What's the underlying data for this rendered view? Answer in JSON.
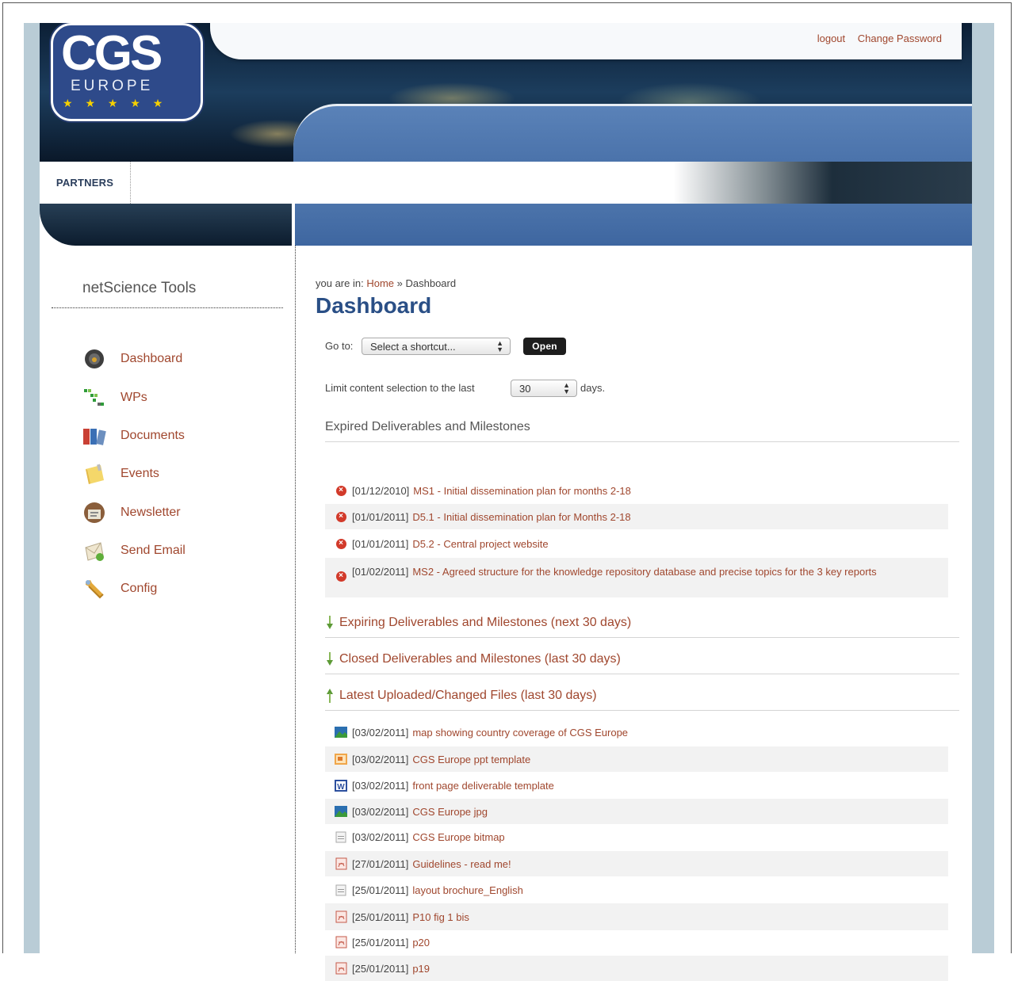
{
  "header": {
    "logo_text": "CGS",
    "logo_sub": "EUROPE",
    "logo_stars": "★ ★ ★ ★ ★",
    "top_links": [
      "logout",
      "Change Password"
    ],
    "nav": [
      "PARTNERS"
    ]
  },
  "sidebar": {
    "title": "netScience Tools",
    "items": [
      {
        "label": "Dashboard",
        "icon": "dashboard-icon"
      },
      {
        "label": "WPs",
        "icon": "wps-icon"
      },
      {
        "label": "Documents",
        "icon": "documents-icon"
      },
      {
        "label": "Events",
        "icon": "events-icon"
      },
      {
        "label": "Newsletter",
        "icon": "newsletter-icon"
      },
      {
        "label": "Send Email",
        "icon": "send-email-icon"
      },
      {
        "label": "Config",
        "icon": "config-icon"
      }
    ]
  },
  "main": {
    "breadcrumb_prefix": "you are in:",
    "breadcrumb_home": "Home",
    "breadcrumb_sep": "»",
    "breadcrumb_current": "Dashboard",
    "title": "Dashboard",
    "goto_label": "Go to:",
    "goto_select": "Select a shortcut...",
    "open_button": "Open",
    "limit_label": "Limit content selection to the last",
    "limit_value": "30",
    "days_label": "days.",
    "sections": {
      "expired": "Expired Deliverables and Milestones",
      "expiring": "Expiring Deliverables and Milestones (next 30 days)",
      "closed": "Closed Deliverables and Milestones (last 30 days)",
      "latest": "Latest Uploaded/Changed Files (last 30 days)"
    },
    "expired_items": [
      {
        "date": "[01/12/2010]",
        "text": "MS1 - Initial dissemination plan for months 2-18"
      },
      {
        "date": "[01/01/2011]",
        "text": "D5.1 - Initial dissemination plan for Months 2-18"
      },
      {
        "date": "[01/01/2011]",
        "text": "D5.2 - Central project website"
      },
      {
        "date": "[01/02/2011]",
        "text": "MS2 - Agreed structure for the knowledge repository database and precise topics for the 3 key reports"
      }
    ],
    "files": [
      {
        "date": "[03/02/2011]",
        "text": "map showing country coverage of CGS Europe",
        "icon": "image-file-icon"
      },
      {
        "date": "[03/02/2011]",
        "text": "CGS Europe ppt template",
        "icon": "ppt-file-icon"
      },
      {
        "date": "[03/02/2011]",
        "text": "front page deliverable template",
        "icon": "word-file-icon"
      },
      {
        "date": "[03/02/2011]",
        "text": "CGS Europe jpg",
        "icon": "image-file-icon"
      },
      {
        "date": "[03/02/2011]",
        "text": "CGS Europe bitmap",
        "icon": "generic-file-icon"
      },
      {
        "date": "[27/01/2011]",
        "text": "Guidelines - read me!",
        "icon": "pdf-file-icon"
      },
      {
        "date": "[25/01/2011]",
        "text": "layout brochure_English",
        "icon": "generic-file-icon"
      },
      {
        "date": "[25/01/2011]",
        "text": "P10 fig 1 bis",
        "icon": "pdf-file-icon"
      },
      {
        "date": "[25/01/2011]",
        "text": "p20",
        "icon": "pdf-file-icon"
      },
      {
        "date": "[25/01/2011]",
        "text": "p19",
        "icon": "pdf-file-icon"
      }
    ]
  }
}
